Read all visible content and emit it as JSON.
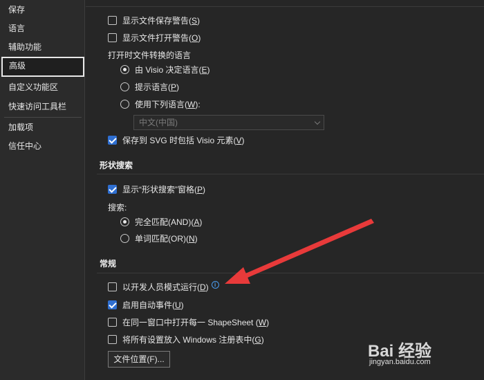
{
  "sidebar": {
    "items": [
      {
        "label": "保存"
      },
      {
        "label": "语言"
      },
      {
        "label": "辅助功能"
      },
      {
        "label": "高级"
      },
      {
        "label": "自定义功能区"
      },
      {
        "label": "快速访问工具栏"
      },
      {
        "label": "加载项"
      },
      {
        "label": "信任中心"
      }
    ],
    "active": "高级"
  },
  "top_options": {
    "show_save_warning": {
      "text": "显示文件保存警告(",
      "key": "S",
      "end": ")",
      "checked": false
    },
    "show_open_warning": {
      "text": "显示文件打开警告(",
      "key": "O",
      "end": ")",
      "checked": false
    }
  },
  "conversion_language": {
    "heading": "打开时文件转换的语言",
    "options": [
      {
        "text": "由 Visio 决定语言(",
        "key": "E",
        "end": ")",
        "selected": true
      },
      {
        "text": "提示语言(",
        "key": "P",
        "end": ")",
        "selected": false
      },
      {
        "text": "使用下列语言(",
        "key": "W",
        "end": "):",
        "selected": false
      }
    ],
    "language_select": "中文(中国)"
  },
  "svg_option": {
    "text": "保存到 SVG 时包括 Visio 元素(",
    "key": "V",
    "end": ")",
    "checked": true
  },
  "shape_search": {
    "title": "形状搜索",
    "show_pane": {
      "text": "显示“形状搜索”窗格(",
      "key": "P",
      "end": ")",
      "checked": true
    },
    "search_label": "搜索:",
    "options": [
      {
        "text": "完全匹配(AND)(",
        "key": "A",
        "end": ")",
        "selected": true
      },
      {
        "text": "单词匹配(OR)(",
        "key": "N",
        "end": ")",
        "selected": false
      }
    ]
  },
  "general": {
    "title": "常规",
    "options": [
      {
        "text": "以开发人员模式运行(",
        "key": "D",
        "end": ")",
        "checked": false
      },
      {
        "text": "启用自动事件(",
        "key": "U",
        "end": ")",
        "checked": true
      },
      {
        "text": "在同一窗口中打开每一 ShapeSheet (",
        "key": "W",
        "end": ")",
        "checked": false
      },
      {
        "text": "将所有设置放入 Windows 注册表中(",
        "key": "G",
        "end": ")",
        "checked": false
      }
    ],
    "info_icon": "i",
    "file_locations_button": "文件位置(F)..."
  },
  "annotation": {
    "color": "#e83a3a"
  },
  "watermark": {
    "logo": "Bai 经验",
    "url": "jingyan.baidu.com"
  }
}
